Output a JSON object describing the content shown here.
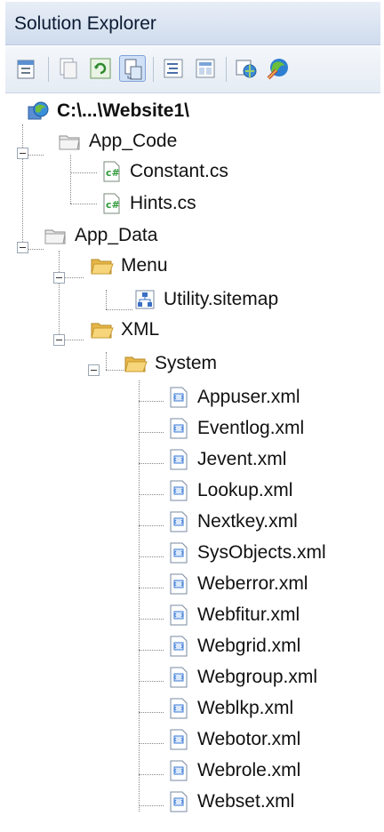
{
  "panel": {
    "title": "Solution Explorer"
  },
  "toolbar": {
    "buttons": [
      {
        "name": "properties-icon"
      },
      {
        "name": "show-all-files-icon"
      },
      {
        "name": "refresh-icon"
      },
      {
        "name": "nest-related-files-icon"
      },
      {
        "name": "view-code-icon"
      },
      {
        "name": "view-designer-icon"
      },
      {
        "name": "copy-website-icon"
      },
      {
        "name": "asp-net-configuration-icon"
      }
    ]
  },
  "tree": {
    "root": "C:\\...\\Website1\\",
    "app_code": {
      "label": "App_Code",
      "files": [
        "Constant.cs",
        "Hints.cs"
      ]
    },
    "app_data": {
      "label": "App_Data",
      "menu": {
        "label": "Menu",
        "files": [
          "Utility.sitemap"
        ]
      },
      "xml": {
        "label": "XML",
        "system": {
          "label": "System",
          "files": [
            "Appuser.xml",
            "Eventlog.xml",
            "Jevent.xml",
            "Lookup.xml",
            "Nextkey.xml",
            "SysObjects.xml",
            "Weberror.xml",
            "Webfitur.xml",
            "Webgrid.xml",
            "Webgroup.xml",
            "Weblkp.xml",
            "Webotor.xml",
            "Webrole.xml",
            "Webset.xml"
          ]
        }
      }
    }
  },
  "colors": {
    "folder": "#f2c75c",
    "folder_dark": "#c99a2e",
    "cs": "#2e9b3a",
    "xml": "#3b7bd4"
  }
}
